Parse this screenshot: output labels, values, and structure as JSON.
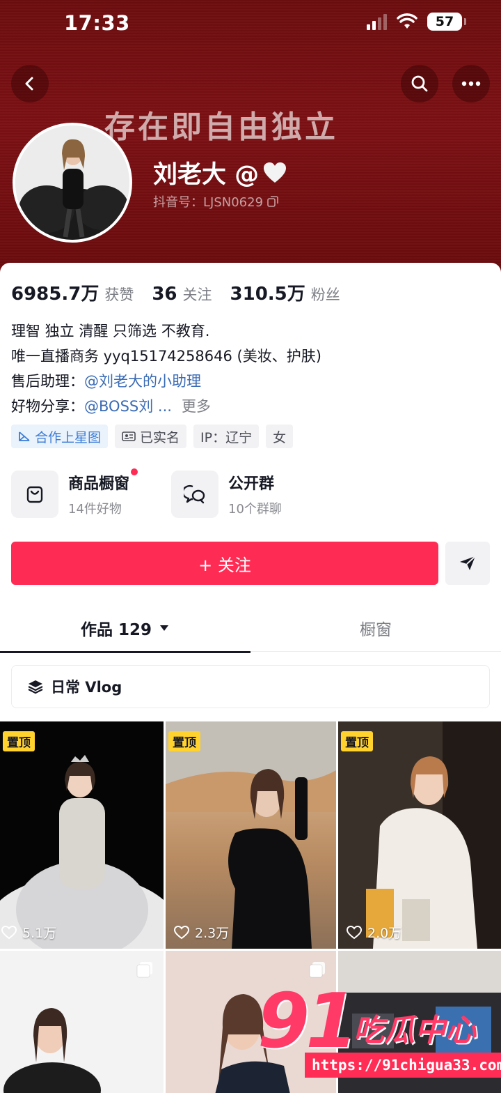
{
  "status_bar": {
    "time": "17:33",
    "battery": "57"
  },
  "profile": {
    "banner_text": "存在即自由独立",
    "nickname": "刘老大 @",
    "douyin_id": "抖音号：LJSN0629"
  },
  "stats": [
    {
      "value": "6985.7万",
      "label": "获赞"
    },
    {
      "value": "36",
      "label": "关注"
    },
    {
      "value": "310.5万",
      "label": "粉丝"
    }
  ],
  "bio": {
    "line1": "理智 独立 清醒 只筛选 不教育.",
    "line2": "唯一直播商务 yyq15174258646 (美妆、护肤)",
    "line3_prefix": "售后助理：",
    "line3_link": "@刘老大的小助理",
    "line4_prefix": "好物分享：",
    "line4_link": "@BOSS刘 ...",
    "more": "更多"
  },
  "tags": [
    "合作上星图",
    "已实名",
    "IP：辽宁",
    "女"
  ],
  "services": [
    {
      "title": "商品橱窗",
      "sub": "14件好物"
    },
    {
      "title": "公开群",
      "sub": "10个群聊"
    }
  ],
  "follow_label": "+ 关注",
  "tabs": {
    "works": "作品 129",
    "showcase": "橱窗"
  },
  "collection_label": "日常 Vlog",
  "videos": [
    {
      "pin": "置顶",
      "likes": "5.1万"
    },
    {
      "pin": "置顶",
      "likes": "2.3万"
    },
    {
      "pin": "置顶",
      "likes": "2.0万"
    }
  ],
  "watermark": {
    "big": "91",
    "cn": "吃瓜中心",
    "url": "https://91chigua33.com"
  },
  "colors": {
    "accent": "#fe2c55",
    "banner": "#7c1014",
    "link": "#3a6bb5"
  }
}
